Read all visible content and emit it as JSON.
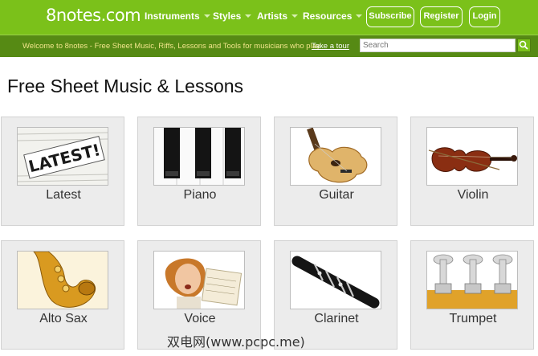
{
  "header": {
    "logo": "8notes.com",
    "nav": [
      "Instruments",
      "Styles",
      "Artists",
      "Resources"
    ],
    "buttons": {
      "subscribe": "Subscribe",
      "register": "Register",
      "login": "Login"
    }
  },
  "subbar": {
    "welcome": "Welcome to 8notes - Free Sheet Music, Riffs, Lessons and Tools for musicians who play.",
    "tour": "Take a tour",
    "search_placeholder": "Search"
  },
  "main": {
    "title": "Free Sheet Music & Lessons",
    "cards": [
      {
        "label": "Latest",
        "thumb_text": "LATEST!"
      },
      {
        "label": "Piano"
      },
      {
        "label": "Guitar"
      },
      {
        "label": "Violin"
      },
      {
        "label": "Alto Sax"
      },
      {
        "label": "Voice"
      },
      {
        "label": "Clarinet"
      },
      {
        "label": "Trumpet"
      }
    ]
  },
  "watermark": "双电网(www.pcpc.me)",
  "colors": {
    "brand_green": "#7bc11a",
    "subbar_green": "#568a14",
    "card_bg": "#ececec"
  }
}
